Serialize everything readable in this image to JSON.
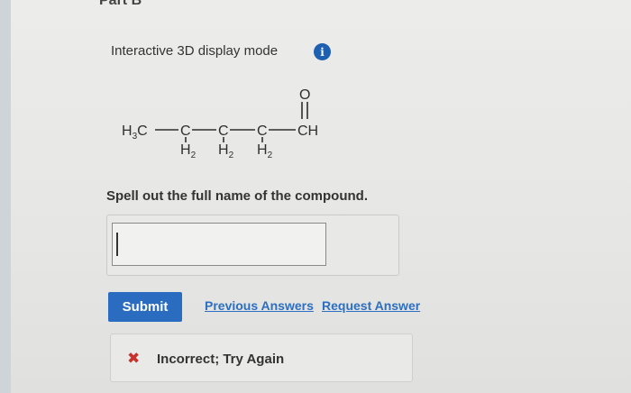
{
  "header": {
    "part_label": "Part B"
  },
  "display_mode": {
    "label": "Interactive 3D display mode",
    "info_icon": "info-icon"
  },
  "structure": {
    "main_chain": [
      "H3C",
      "C",
      "C",
      "C",
      "CH"
    ],
    "h2_labels": [
      "H2",
      "H2",
      "H2"
    ],
    "carbonyl_oxygen": "O"
  },
  "question": {
    "prompt": "Spell out the full name of the compound."
  },
  "answer": {
    "value": "",
    "placeholder": ""
  },
  "actions": {
    "submit_label": "Submit",
    "previous_answers_label": "Previous Answers",
    "request_answer_label": "Request Answer"
  },
  "feedback": {
    "icon": "incorrect-x-icon",
    "text": "Incorrect; Try Again"
  }
}
